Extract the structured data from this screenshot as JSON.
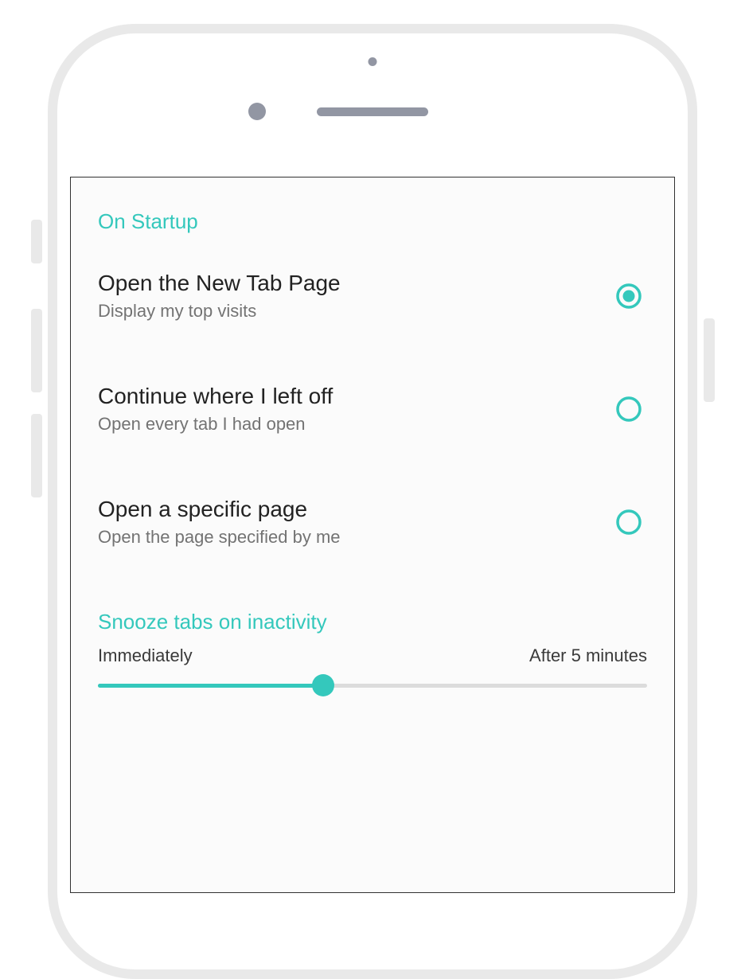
{
  "colors": {
    "accent": "#34c8bc",
    "text_primary": "#222222",
    "text_secondary": "#737373",
    "frame": "#e9e9e9",
    "hardware_dot": "#9296a3",
    "slider_track": "#dcdcdc"
  },
  "sections": {
    "startup": {
      "title": "On Startup",
      "options": [
        {
          "title": "Open the New Tab Page",
          "subtitle": "Display my top visits",
          "selected": true
        },
        {
          "title": "Continue where I left off",
          "subtitle": "Open every tab I had open",
          "selected": false
        },
        {
          "title": "Open a specific page",
          "subtitle": "Open the page specified by me",
          "selected": false
        }
      ]
    },
    "snooze": {
      "title": "Snooze tabs on inactivity",
      "min_label": "Immediately",
      "max_label": "After 5 minutes",
      "value_percent": 41
    }
  }
}
